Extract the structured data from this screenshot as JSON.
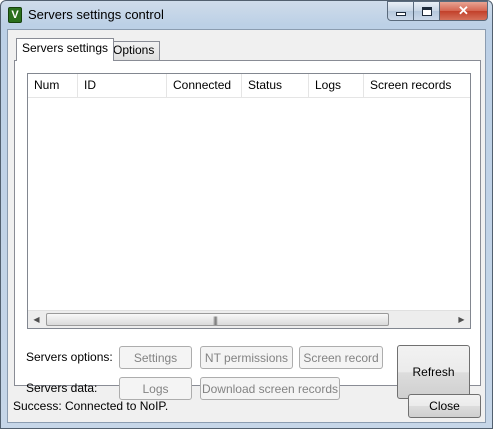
{
  "window": {
    "title": "Servers settings control",
    "icon": "app-icon",
    "icon_glyph": "V",
    "caption_close": "✕"
  },
  "tabs": [
    {
      "label": "Servers settings",
      "active": true
    },
    {
      "label": "Options",
      "active": false
    }
  ],
  "servers_list": {
    "columns": [
      "Num",
      "ID",
      "Connected",
      "Status",
      "Logs",
      "Screen records"
    ],
    "rows": [],
    "scroll_grip": "|||"
  },
  "servers_options": {
    "label": "Servers options:",
    "settings_button": "Settings",
    "nt_permissions_button": "NT permissions",
    "screen_record_button": "Screen record"
  },
  "servers_data": {
    "label": "Servers data:",
    "logs_button": "Logs",
    "download_button": "Download screen records"
  },
  "refresh_button": "Refresh",
  "status_text": "Success: Connected to NoIP.",
  "close_button": "Close"
}
